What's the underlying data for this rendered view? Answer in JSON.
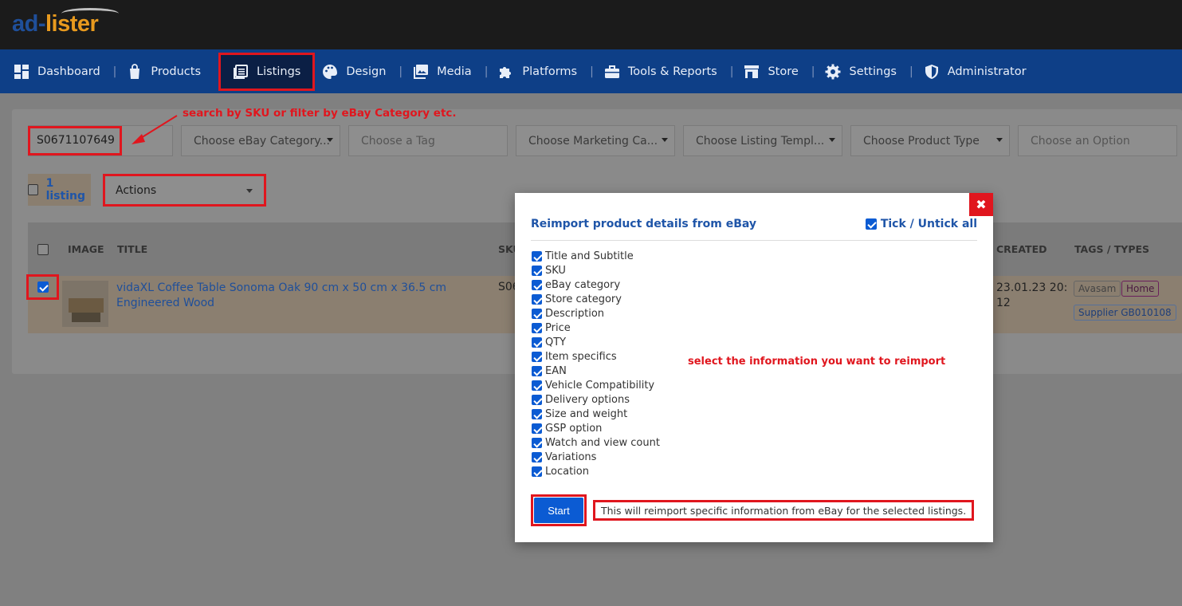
{
  "brand": {
    "logo_part1": "ad-",
    "logo_part2": "lister"
  },
  "nav": [
    {
      "label": "Dashboard",
      "icon": "dashboard-icon"
    },
    {
      "label": "Products",
      "icon": "shopping-bag-icon"
    },
    {
      "label": "Listings",
      "icon": "listings-icon"
    },
    {
      "label": "Design",
      "icon": "palette-icon"
    },
    {
      "label": "Media",
      "icon": "image-icon"
    },
    {
      "label": "Platforms",
      "icon": "puzzle-icon"
    },
    {
      "label": "Tools & Reports",
      "icon": "toolbox-icon"
    },
    {
      "label": "Store",
      "icon": "store-icon"
    },
    {
      "label": "Settings",
      "icon": "gear-icon"
    },
    {
      "label": "Administrator",
      "icon": "shield-icon"
    }
  ],
  "filters": {
    "sku_value": "S0671107649",
    "ebay_category": "Choose eBay Category...",
    "tag": "Choose a Tag",
    "marketing": "Choose Marketing Ca...",
    "template": "Choose Listing Templ...",
    "product_type": "Choose Product Type",
    "option": "Choose an Option"
  },
  "annotations": {
    "search": "search by SKU or filter by eBay Category etc.",
    "select": "select the information you want to reimport"
  },
  "toolbar": {
    "count": "1 listing",
    "actions": "Actions"
  },
  "table": {
    "headers": {
      "image": "IMAGE",
      "title": "TITLE",
      "sku": "SKU",
      "created": "CREATED",
      "tags": "TAGS / TYPES"
    },
    "row": {
      "title": "vidaXL Coffee Table Sonoma Oak 90 cm x 50 cm x 36.5 cm Engineered Wood",
      "sku": "S06",
      "created": "23.01.23 20:12",
      "tags": [
        "Avasam",
        "Home",
        "Supplier GB010108"
      ]
    }
  },
  "modal": {
    "close": "✖",
    "title": "Reimport product details from eBay",
    "tick_all": "Tick / Untick all",
    "options": [
      "Title and Subtitle",
      "SKU",
      "eBay category",
      "Store category",
      "Description",
      "Price",
      "QTY",
      "Item specifics",
      "EAN",
      "Vehicle Compatibility",
      "Delivery options",
      "Size and weight",
      "GSP option",
      "Watch and view count",
      "Variations",
      "Location"
    ],
    "start": "Start",
    "note": "This will reimport specific information from eBay for the selected listings."
  },
  "colors": {
    "nav": "#0e3f87",
    "accent_red": "#e0161e",
    "primary": "#0b5bd3"
  }
}
